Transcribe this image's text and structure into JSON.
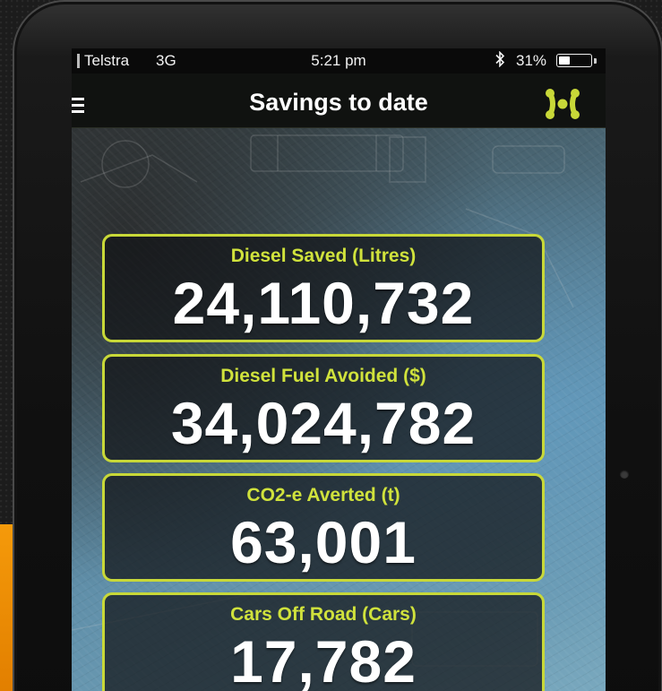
{
  "status_bar": {
    "carrier": "Telstra",
    "network": "3G",
    "time": "5:21 pm",
    "bluetooth_icon": "bluetooth-icon",
    "battery_percent": "31%",
    "battery_level": 0.31
  },
  "nav_bar": {
    "menu_icon": "hamburger-menu-icon",
    "title": "Savings to date",
    "logo_icon": "app-logo-icon"
  },
  "stats": [
    {
      "label": "Diesel Saved (Litres)",
      "value": "24,110,732"
    },
    {
      "label": "Diesel Fuel Avoided ($)",
      "value": "34,024,782"
    },
    {
      "label": "CO2-e Averted (t)",
      "value": "63,001"
    },
    {
      "label": "Cars Off Road (Cars)",
      "value": "17,782"
    }
  ],
  "colors": {
    "accent": "#c8d838",
    "label": "#d0e23c",
    "value": "#ffffff",
    "background_orange": "#f59a0a"
  }
}
